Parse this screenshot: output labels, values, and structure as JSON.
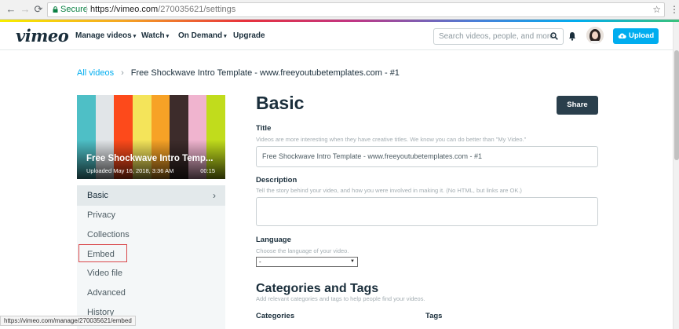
{
  "browser": {
    "secure_label": "Secure",
    "url_host": "https://vimeo.com",
    "url_path": "/270035621/settings",
    "status_url": "https://vimeo.com/manage/270035621/embed"
  },
  "header": {
    "logo": "vimeo",
    "nav": [
      "Manage videos",
      "Watch",
      "On Demand",
      "Upgrade"
    ],
    "search_placeholder": "Search videos, people, and more",
    "upload_label": "Upload"
  },
  "breadcrumb": {
    "root": "All videos",
    "separator": "›",
    "current": "Free Shockwave Intro Template - www.freeyoutubetemplates.com - #1"
  },
  "video": {
    "title": "Free Shockwave Intro Temp...",
    "uploaded": "Uploaded May 16, 2018, 3:36 AM",
    "duration": "00:15",
    "bar_colors": [
      "#4ebfc6",
      "#e1e5e8",
      "#fd4a1b",
      "#f4e45a",
      "#f7a226",
      "#3d2c2b",
      "#f0b4cf",
      "#c1dc1c"
    ]
  },
  "side_menu": {
    "items": [
      "Basic",
      "Privacy",
      "Collections",
      "Embed",
      "Video file",
      "Advanced",
      "History"
    ],
    "active_chevron": "›"
  },
  "form": {
    "heading": "Basic",
    "share_label": "Share",
    "title_label": "Title",
    "title_help": "Videos are more interesting when they have creative titles. We know you can do better than \"My Video.\"",
    "title_value": "Free Shockwave Intro Template - www.freeyoutubetemplates.com - #1",
    "description_label": "Description",
    "description_help": "Tell the story behind your video, and how you were involved in making it. (No HTML, but links are OK.)",
    "language_label": "Language",
    "language_help": "Choose the language of your video.",
    "language_value": "-",
    "cat_heading": "Categories and Tags",
    "cat_help": "Add relevant categories and tags to help people find your videos.",
    "categories_label": "Categories",
    "tags_label": "Tags"
  },
  "colors": {
    "accent": "#00adef",
    "share_bg": "#2a3f4c",
    "text": "#1a2e3b",
    "highlight_box": "#d9484b"
  }
}
